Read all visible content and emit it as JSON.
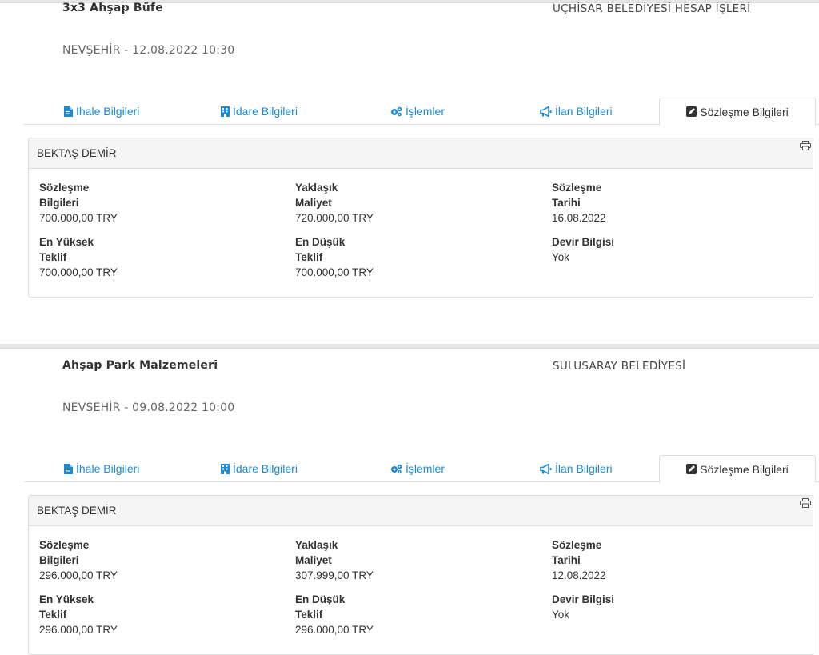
{
  "tabs": {
    "ihale": "İhale Bilgileri",
    "idare": "İdare Bilgileri",
    "islemler": "İşlemler",
    "ilan": "İlan Bilgileri",
    "sozlesme": "Sözleşme Bilgileri"
  },
  "labels": {
    "contract_value": "Sözleşme Bilgileri",
    "approx_cost": "Yaklaşık Maliyet",
    "contract_date": "Sözleşme Tarihi",
    "highest_bid": "En Yüksek Teklif",
    "lowest_bid": "En Düşük Teklif",
    "transfer_info": "Devir Bilgisi"
  },
  "colors": {
    "link": "#1a8bd4",
    "border": "#dddddd",
    "panel_header_bg": "#f5f5f5"
  },
  "icons": {
    "ihale": "document-icon",
    "idare": "building-icon",
    "islemler": "gears-icon",
    "ilan": "megaphone-icon",
    "sozlesme": "edit-icon",
    "print": "print-icon"
  },
  "tenders": [
    {
      "title": "3x3 Ahşap Büfe",
      "institution": "UÇHİSAR BELEDİYESİ HESAP İŞLERİ",
      "location_date": "NEVŞEHİR - 12.08.2022 10:30",
      "contractor": "BEKTAŞ DEMİR",
      "contract_value": "700.000,00 TRY",
      "approx_cost": "720.000,00 TRY",
      "contract_date": "16.08.2022",
      "highest_bid": "700.000,00 TRY",
      "lowest_bid": "700.000,00 TRY",
      "transfer_info": "Yok"
    },
    {
      "title": "Ahşap Park Malzemeleri",
      "institution": "SULUSARAY BELEDİYESİ",
      "location_date": "NEVŞEHİR - 09.08.2022 10:00",
      "contractor": "BEKTAŞ DEMİR",
      "contract_value": "296.000,00 TRY",
      "approx_cost": "307.999,00 TRY",
      "contract_date": "12.08.2022",
      "highest_bid": "296.000,00 TRY",
      "lowest_bid": "296.000,00 TRY",
      "transfer_info": "Yok"
    }
  ]
}
